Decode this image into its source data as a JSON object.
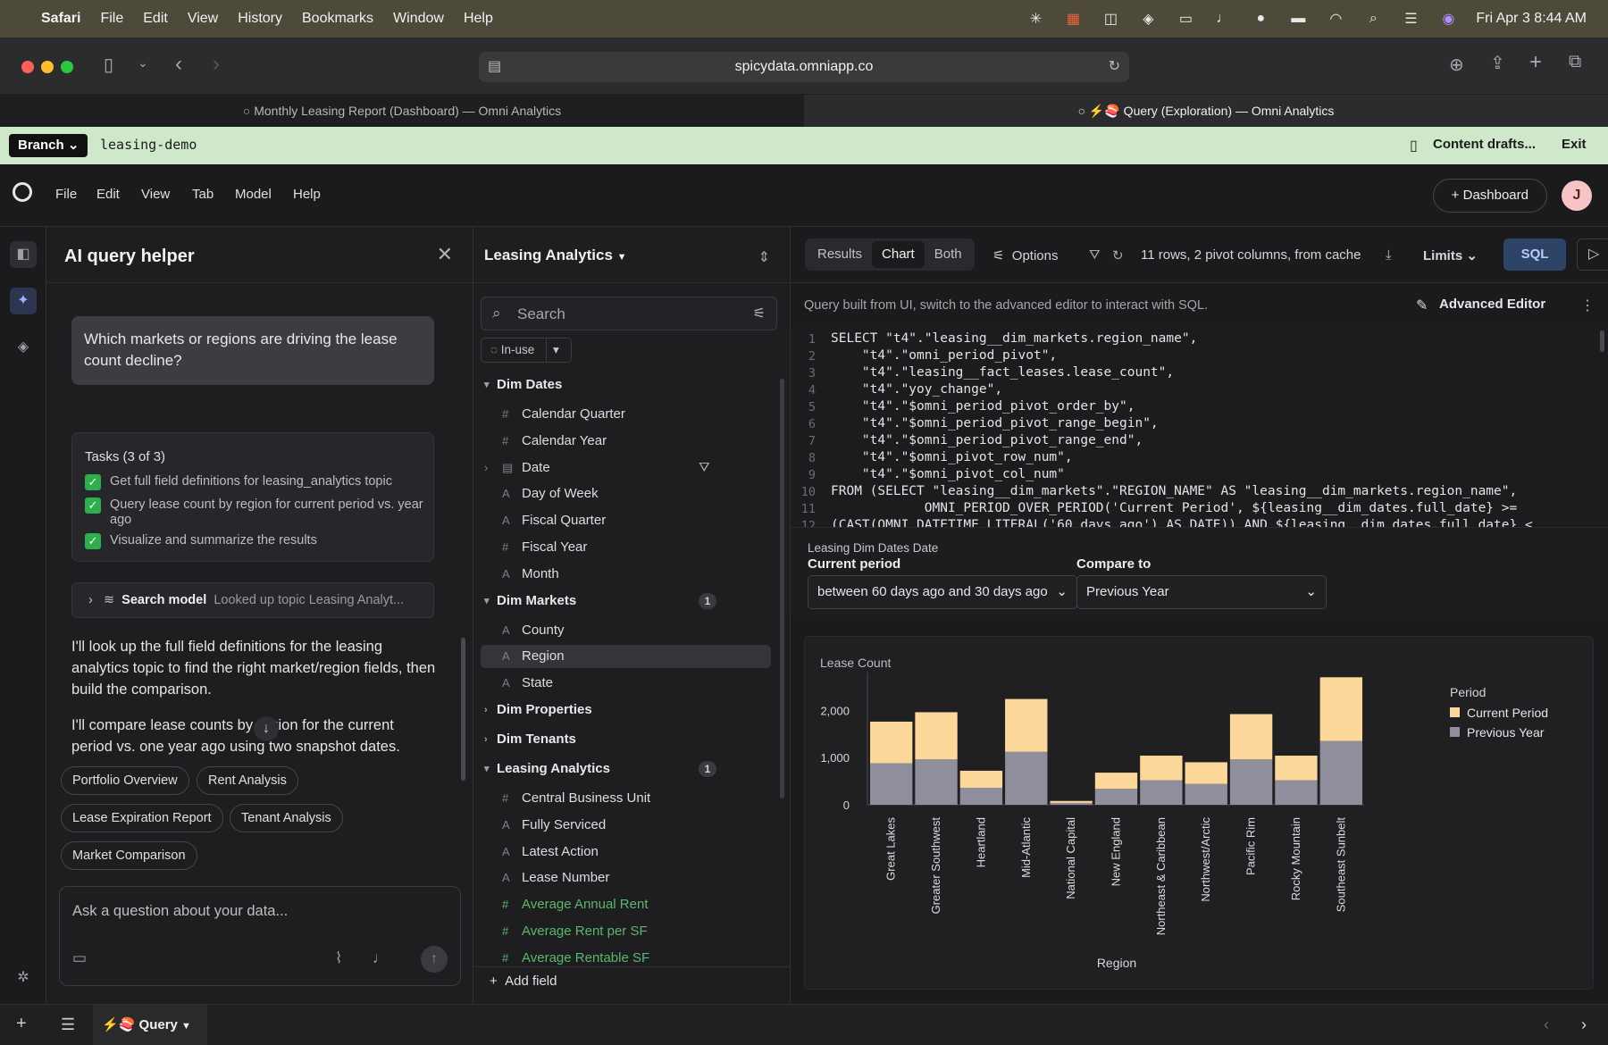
{
  "menubar": {
    "app": "Safari",
    "items": [
      "File",
      "Edit",
      "View",
      "History",
      "Bookmarks",
      "Window",
      "Help"
    ],
    "datetime": "Fri Apr 3  8:44 AM"
  },
  "browser": {
    "url": "spicydata.omniapp.co",
    "tabs": [
      {
        "title": "Monthly Leasing Report (Dashboard) — Omni Analytics"
      },
      {
        "title": "⚡🍣 Query (Exploration) — Omni Analytics"
      }
    ]
  },
  "branchbar": {
    "branch_label": "Branch",
    "branch_name": "leasing-demo",
    "drafts": "Content drafts...",
    "exit": "Exit"
  },
  "app_menu": [
    "File",
    "Edit",
    "View",
    "Tab",
    "Model",
    "Help"
  ],
  "header": {
    "dashboard_btn": "Dashboard",
    "avatar": "J"
  },
  "ai": {
    "title": "AI query helper",
    "user_message": "Which markets or regions are driving the lease count decline?",
    "tasks_title": "Tasks (3 of 3)",
    "tasks": [
      "Get full field definitions for leasing_analytics topic",
      "Query lease count by region for current period vs. year ago",
      "Visualize and summarize the results"
    ],
    "search_model_label": "Search model",
    "search_model_detail": "Looked up topic Leasing Analyt...",
    "para1": "I'll look up the full field definitions for the leasing analytics topic to find the right market/region fields, then build the comparison.",
    "para2": "I'll compare lease counts by region for the current period vs. one year ago using two snapshot dates.",
    "chips": [
      "Portfolio Overview",
      "Rent Analysis",
      "Lease Expiration Report",
      "Tenant Analysis",
      "Market Comparison"
    ],
    "placeholder": "Ask a question about your data..."
  },
  "picker": {
    "title": "Leasing Analytics",
    "search_placeholder": "Search",
    "in_use": "In-use",
    "rows": [
      {
        "type": "group",
        "label": "Dim Dates",
        "open": true
      },
      {
        "type": "num",
        "label": "Calendar Quarter"
      },
      {
        "type": "num",
        "label": "Calendar Year"
      },
      {
        "type": "date",
        "label": "Date"
      },
      {
        "type": "str",
        "label": "Day of Week"
      },
      {
        "type": "str",
        "label": "Fiscal Quarter"
      },
      {
        "type": "num",
        "label": "Fiscal Year"
      },
      {
        "type": "str",
        "label": "Month"
      },
      {
        "type": "group",
        "label": "Dim Markets",
        "open": true,
        "count": "1"
      },
      {
        "type": "str",
        "label": "County"
      },
      {
        "type": "str",
        "label": "Region",
        "selected": true
      },
      {
        "type": "str",
        "label": "State"
      },
      {
        "type": "group",
        "label": "Dim Properties",
        "open": false
      },
      {
        "type": "group",
        "label": "Dim Tenants",
        "open": false
      },
      {
        "type": "group",
        "label": "Leasing Analytics",
        "open": true,
        "count": "1"
      },
      {
        "type": "num",
        "label": "Central Business Unit"
      },
      {
        "type": "str",
        "label": "Fully Serviced"
      },
      {
        "type": "str",
        "label": "Latest Action"
      },
      {
        "type": "str",
        "label": "Lease Number"
      },
      {
        "type": "measure",
        "label": "Average Annual Rent"
      },
      {
        "type": "measure",
        "label": "Average Rent per SF"
      },
      {
        "type": "measure",
        "label": "Average Rentable SF"
      }
    ],
    "add_field": "Add field"
  },
  "results": {
    "tabs": [
      "Results",
      "Chart",
      "Both"
    ],
    "active_tab": "Chart",
    "options": "Options",
    "status": "11 rows, 2 pivot columns, from cache",
    "limits": "Limits",
    "sql": "SQL",
    "note": "Query built from UI, switch to the advanced editor to interact with SQL.",
    "advanced_editor": "Advanced Editor"
  },
  "sql_lines": [
    "SELECT \"t4\".\"leasing__dim_markets.region_name\",",
    "    \"t4\".\"omni_period_pivot\",",
    "    \"t4\".\"leasing__fact_leases.lease_count\",",
    "    \"t4\".\"yoy_change\",",
    "    \"t4\".\"$omni_period_pivot_order_by\",",
    "    \"t4\".\"$omni_period_pivot_range_begin\",",
    "    \"t4\".\"$omni_period_pivot_range_end\",",
    "    \"t4\".\"$omni_pivot_row_num\",",
    "    \"t4\".\"$omni_pivot_col_num\"",
    "FROM (SELECT \"leasing__dim_markets\".\"REGION_NAME\" AS \"leasing__dim_markets.region_name\",",
    "            OMNI_PERIOD_OVER_PERIOD('Current Period', ${leasing__dim_dates.full_date} >=",
    "(CAST(OMNI_DATETIME_LITERAL('60 days ago') AS DATE)) AND ${leasing__dim_dates.full_date} <"
  ],
  "filter": {
    "field": "Leasing Dim Dates Date",
    "current_label": "Current period",
    "current_value": "between 60 days ago and 30 days ago",
    "compare_label": "Compare to",
    "compare_value": "Previous Year"
  },
  "chart_data": {
    "type": "bar",
    "stacked": true,
    "ylabel": "Lease Count",
    "xlabel": "Region",
    "legend_title": "Period",
    "ylim": [
      0,
      2800
    ],
    "yticks": [
      "0",
      "1,000",
      "2,000"
    ],
    "categories": [
      "Great Lakes",
      "Greater Southwest",
      "Heartland",
      "Mid-Atlantic",
      "National Capital",
      "New England",
      "Northeast & Caribbean",
      "Northwest/Arctic",
      "Pacific Rim",
      "Rocky Mountain",
      "Southeast Sunbelt"
    ],
    "series": [
      {
        "name": "Previous Year",
        "color": "#8f8e9c",
        "values": [
          880,
          960,
          360,
          1120,
          40,
          340,
          520,
          440,
          960,
          520,
          1350
        ]
      },
      {
        "name": "Current Period",
        "color": "#fbd79a",
        "values": [
          880,
          1000,
          360,
          1120,
          40,
          340,
          520,
          460,
          960,
          520,
          1350
        ]
      }
    ]
  },
  "bottom": {
    "query_tab": "⚡🍣 Query"
  }
}
